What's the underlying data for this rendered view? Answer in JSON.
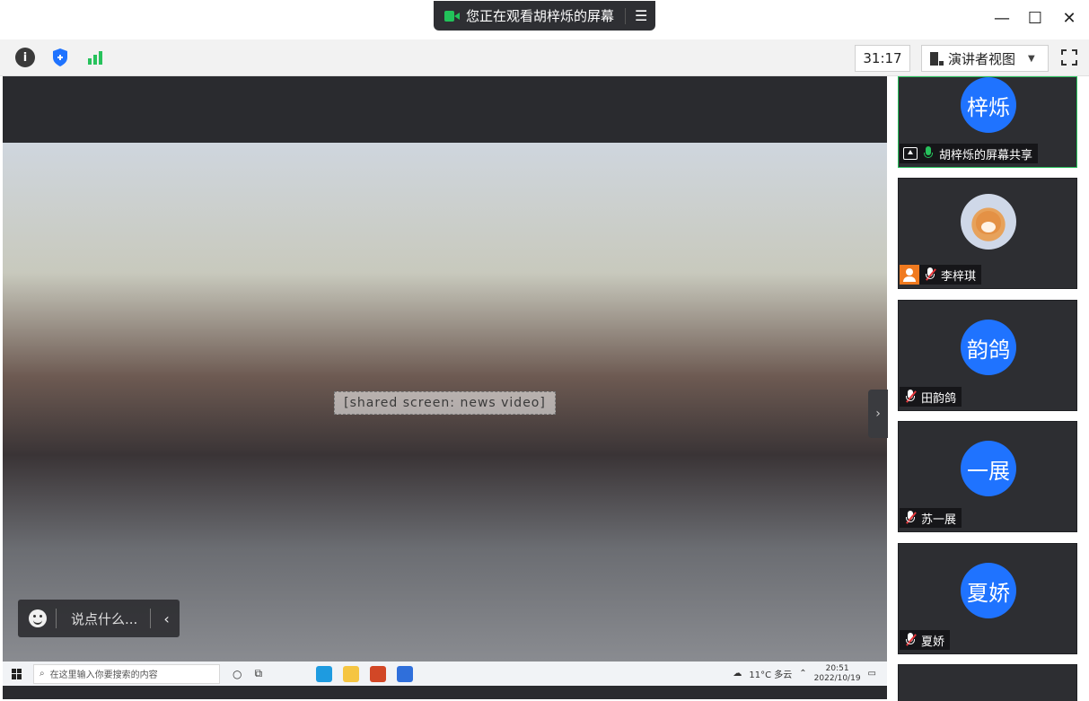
{
  "titlebar": {
    "share_status": "您正在观看胡梓烁的屏幕",
    "menu_icon": "list-menu-icon",
    "window_controls": [
      "minimize-icon",
      "maximize-icon",
      "close-icon"
    ]
  },
  "toolbar": {
    "icons": [
      "info-icon",
      "shield-icon",
      "signal-bars-icon"
    ],
    "timer": "31:17",
    "view_mode": "演讲者视图",
    "fullscreen_icon": "fullscreen-icon"
  },
  "main": {
    "chat_placeholder": "说点什么...",
    "video_placeholder": "[shared screen: news video]"
  },
  "taskbar": {
    "search_placeholder": "在这里输入你要搜索的内容",
    "weather": "11°C 多云",
    "time": "20:51",
    "date": "2022/10/19"
  },
  "participants": [
    {
      "avatar_text": "梓烁",
      "name": "胡梓烁的屏幕共享",
      "mic": "on",
      "sharing": true
    },
    {
      "avatar_text": "",
      "name": "李梓琪",
      "mic": "muted",
      "photo": true
    },
    {
      "avatar_text": "韵鸽",
      "name": "田韵鸽",
      "mic": "muted"
    },
    {
      "avatar_text": "一展",
      "name": "苏一展",
      "mic": "muted"
    },
    {
      "avatar_text": "夏娇",
      "name": "夏娇",
      "mic": "muted"
    }
  ],
  "colors": {
    "avatar_blue": "#1f73ff",
    "active_border": "#27c25c",
    "muted_red": "#e8373b"
  }
}
